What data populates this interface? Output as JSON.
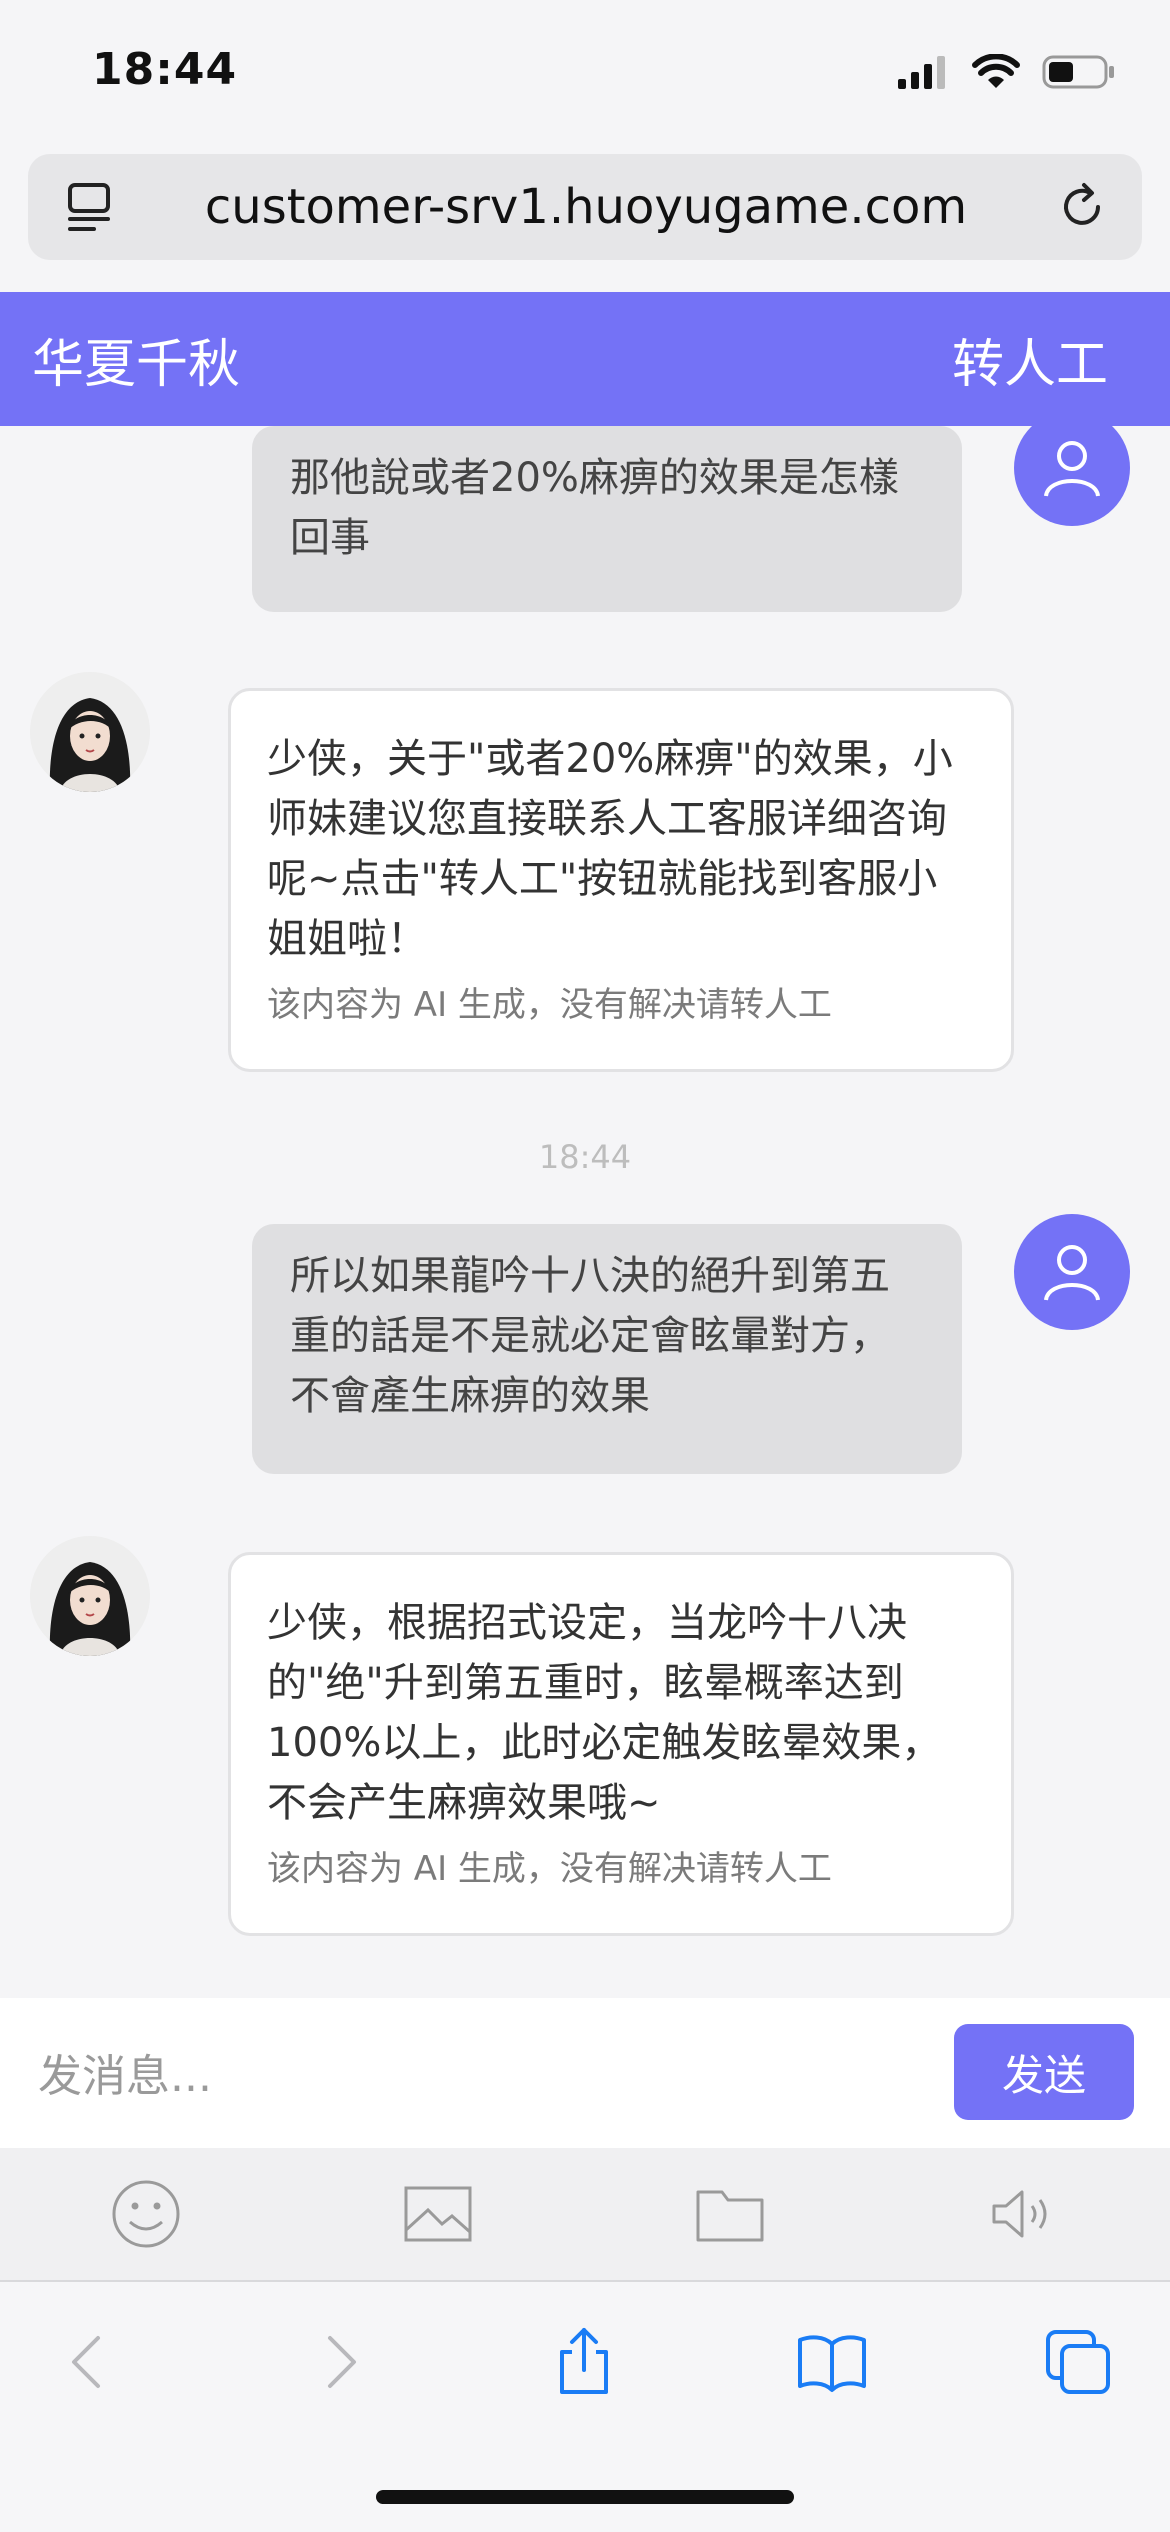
{
  "status": {
    "time": "18:44"
  },
  "browser": {
    "url": "customer-srv1.huoyugame.com"
  },
  "header": {
    "title": "华夏千秋",
    "transfer_label": "转人工"
  },
  "chat": {
    "messages": [
      {
        "role": "user",
        "text": "那他說或者20%麻痹的效果是怎樣回事"
      },
      {
        "role": "bot",
        "text": "少侠，关于\"或者20%麻痹\"的效果，小师妹建议您直接联系人工客服详细咨询呢~点击\"转人工\"按钮就能找到客服小姐姐啦！",
        "note": "该内容为 AI 生成，没有解决请转人工"
      },
      {
        "role": "timestamp",
        "text": "18:44"
      },
      {
        "role": "user",
        "text": "所以如果龍吟十八決的絕升到第五重的話是不是就必定會眩暈對方，不會產生麻痹的效果"
      },
      {
        "role": "bot",
        "text": "少侠，根据招式设定，当龙吟十八决的\"绝\"升到第五重时，眩晕概率达到100%以上，此时必定触发眩晕效果，不会产生麻痹效果哦~",
        "note": "该内容为 AI 生成，没有解决请转人工"
      }
    ]
  },
  "composer": {
    "placeholder": "发消息...",
    "send_label": "发送"
  },
  "tools": [
    "emoji-icon",
    "image-icon",
    "folder-icon",
    "speaker-icon"
  ],
  "colors": {
    "accent": "#7472f6",
    "safari_blue": "#1a7cf5"
  }
}
